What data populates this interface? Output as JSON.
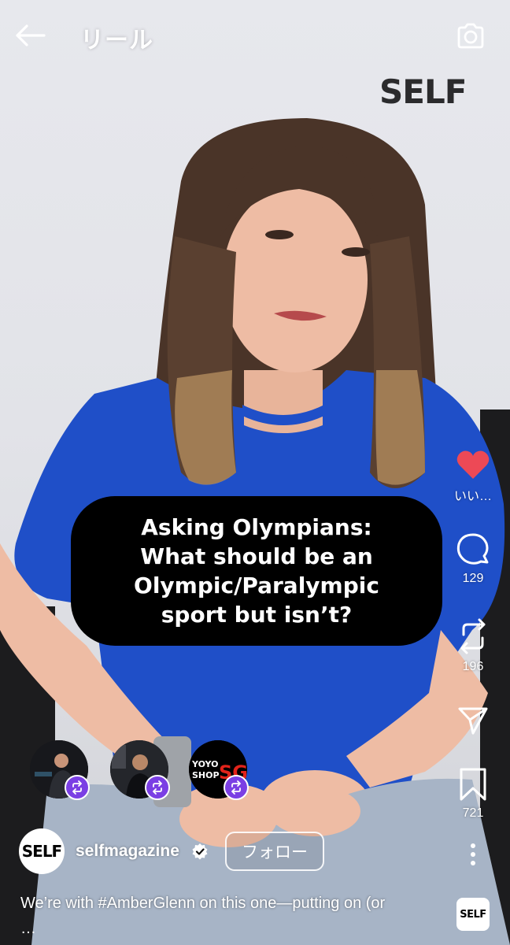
{
  "header": {
    "title": "リール"
  },
  "video": {
    "watermark": "SELF",
    "headline": "Asking Olympians:\nWhat should be an\nOlympic/Paralympic\nsport but isn’t?"
  },
  "actions": {
    "like_label": "いい…",
    "like_color": "#ed4956",
    "comments": "129",
    "reposts": "196",
    "saves": "721"
  },
  "remixes": [
    {
      "name": "remix-avatar-1"
    },
    {
      "name": "remix-avatar-2"
    },
    {
      "name": "remix-avatar-3",
      "text_line1": "YOYO",
      "text_line2": "SHOP",
      "badge": "SG"
    }
  ],
  "author": {
    "avatar_text": "SELF",
    "username": "selfmagazine",
    "verified": true,
    "follow_label": "フォロー"
  },
  "caption": {
    "prefix": "We’re with ",
    "hashtag": "#AmberGlenn",
    "suffix": " on this one—putting on (or",
    "more": "…"
  },
  "audio": {
    "thumb_text": "SELF"
  },
  "colors": {
    "accent_remix": "#7b3fe4",
    "shirt": "#1f4fc8"
  }
}
